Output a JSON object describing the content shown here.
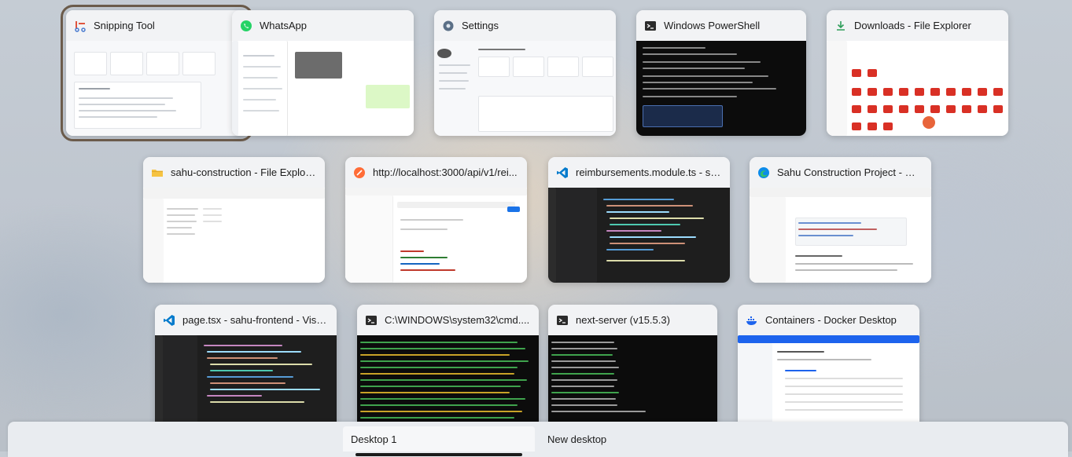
{
  "windows": [
    {
      "title": "Snipping Tool",
      "icon": "snipping-tool-icon"
    },
    {
      "title": "WhatsApp",
      "icon": "whatsapp-icon"
    },
    {
      "title": "Settings",
      "icon": "settings-icon"
    },
    {
      "title": "Windows PowerShell",
      "icon": "powershell-icon"
    },
    {
      "title": "Downloads - File Explorer",
      "icon": "downloads-icon"
    },
    {
      "title": "sahu-construction - File Explorer",
      "icon": "folder-icon"
    },
    {
      "title": "http://localhost:3000/api/v1/rei...",
      "icon": "postman-icon"
    },
    {
      "title": "reimbursements.module.ts - sah...",
      "icon": "vscode-icon"
    },
    {
      "title": "Sahu Construction Project - We...",
      "icon": "edge-icon"
    },
    {
      "title": "page.tsx - sahu-frontend - Visua...",
      "icon": "vscode-icon"
    },
    {
      "title": "C:\\WINDOWS\\system32\\cmd....",
      "icon": "cmd-icon"
    },
    {
      "title": "next-server (v15.5.3)",
      "icon": "cmd-icon"
    },
    {
      "title": "Containers - Docker Desktop",
      "icon": "docker-icon"
    }
  ],
  "desktops": {
    "desktop_1": "Desktop 1",
    "new_desktop": "New desktop"
  },
  "colors": {
    "selection_outline": "#6b5b4b",
    "whatsapp": "#25d366",
    "vscode": "#007acc",
    "docker": "#1d63ed",
    "postman": "#ff6c37",
    "folder": "#f6c342",
    "downloads": "#2f9e5b"
  }
}
